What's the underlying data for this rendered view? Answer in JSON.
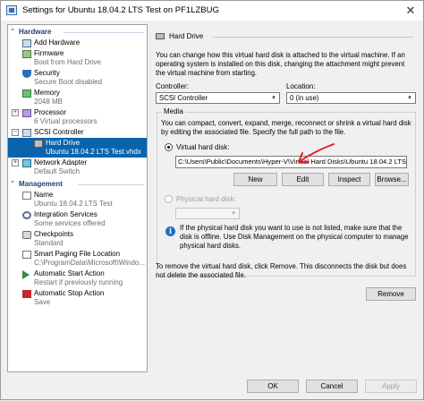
{
  "window": {
    "title": "Settings for Ubuntu 18.04.2 LTS Test on PF1LZBUG",
    "close_glyph": "✕"
  },
  "tree": {
    "hardware_heading": "Hardware",
    "management_heading": "Management",
    "hardware_items": [
      {
        "label": "Add Hardware",
        "sub": "",
        "icon": "add-hardware-icon"
      },
      {
        "label": "Firmware",
        "sub": "Boot from Hard Drive",
        "icon": "firmware-icon"
      },
      {
        "label": "Security",
        "sub": "Secure Boot disabled",
        "icon": "shield-icon"
      },
      {
        "label": "Memory",
        "sub": "2048 MB",
        "icon": "memory-icon"
      },
      {
        "label": "Processor",
        "sub": "6 Virtual processors",
        "icon": "processor-icon"
      },
      {
        "label": "SCSI Controller",
        "sub": "",
        "icon": "scsi-controller-icon"
      },
      {
        "label": "Hard Drive",
        "sub": "Ubuntu 18.04.2 LTS Test.vhdx",
        "icon": "hard-drive-icon"
      },
      {
        "label": "Network Adapter",
        "sub": "Default Switch",
        "icon": "network-adapter-icon"
      }
    ],
    "management_items": [
      {
        "label": "Name",
        "sub": "Ubuntu 18.04.2 LTS Test",
        "icon": "name-icon"
      },
      {
        "label": "Integration Services",
        "sub": "Some services offered",
        "icon": "integration-services-icon"
      },
      {
        "label": "Checkpoints",
        "sub": "Standard",
        "icon": "checkpoints-icon"
      },
      {
        "label": "Smart Paging File Location",
        "sub": "C:\\ProgramData\\Microsoft\\Windo...",
        "icon": "smart-paging-icon"
      },
      {
        "label": "Automatic Start Action",
        "sub": "Restart if previously running",
        "icon": "automatic-start-icon"
      },
      {
        "label": "Automatic Stop Action",
        "sub": "Save",
        "icon": "automatic-stop-icon"
      }
    ]
  },
  "panel": {
    "heading": "Hard Drive",
    "description": "You can change how this virtual hard disk is attached to the virtual machine. If an operating system is installed on this disk, changing the attachment might prevent the virtual machine from starting.",
    "controller_label": "Controller:",
    "controller_value": "SCSI Controller",
    "location_label": "Location:",
    "location_value": "0 (in use)",
    "media_legend": "Media",
    "media_description": "You can compact, convert, expand, merge, reconnect or shrink a virtual hard disk by editing the associated file. Specify the full path to the file.",
    "vhd_radio_label": "Virtual hard disk:",
    "vhd_path": "C:\\Users\\Public\\Documents\\Hyper-V\\Virtual Hard Disks\\Ubuntu 18.04.2 LTS Test",
    "new_label": "New",
    "edit_label": "Edit",
    "inspect_label": "Inspect",
    "browse_label": "Browse...",
    "physical_radio_label": "Physical hard disk:",
    "physical_value": "",
    "info_text": "If the physical hard disk you want to use is not listed, make sure that the disk is offline. Use Disk Management on the physical computer to manage physical hard disks.",
    "remove_description": "To remove the virtual hard disk, click Remove. This disconnects the disk but does not delete the associated file.",
    "remove_label": "Remove"
  },
  "footer": {
    "ok_label": "OK",
    "cancel_label": "Cancel",
    "apply_label": "Apply"
  },
  "colors": {
    "selection": "#0a64ad",
    "section_heading": "#1e3f7a",
    "annotation_arrow": "#e0202a"
  }
}
